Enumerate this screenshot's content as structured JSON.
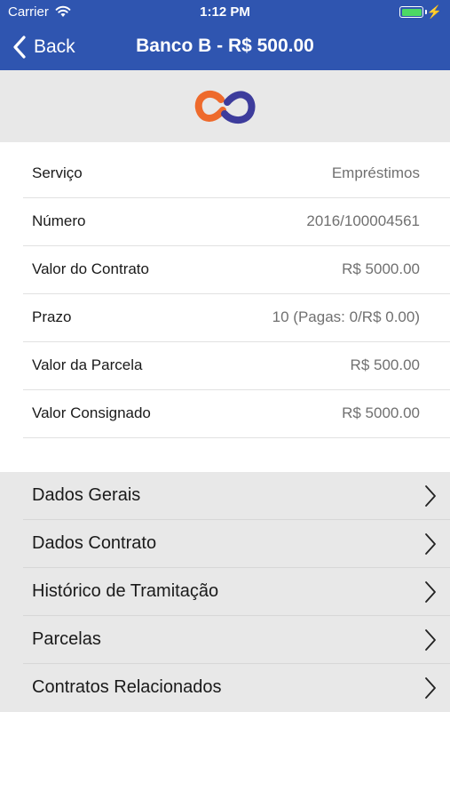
{
  "status_bar": {
    "carrier": "Carrier",
    "time": "1:12 PM",
    "battery_color": "#4cd964"
  },
  "nav": {
    "back_label": "Back",
    "title": "Banco B - R$ 500.00",
    "bar_color": "#2f55b0"
  },
  "details": [
    {
      "label": "Serviço",
      "value": "Empréstimos"
    },
    {
      "label": "Número",
      "value": "2016/100004561"
    },
    {
      "label": "Valor do Contrato",
      "value": "R$ 5000.00"
    },
    {
      "label": "Prazo",
      "value": "10 (Pagas: 0/R$ 0.00)"
    },
    {
      "label": "Valor da Parcela",
      "value": "R$ 500.00"
    },
    {
      "label": "Valor Consignado",
      "value": "R$ 5000.00"
    }
  ],
  "menu": [
    {
      "label": "Dados Gerais"
    },
    {
      "label": "Dados Contrato"
    },
    {
      "label": "Histórico de Tramitação"
    },
    {
      "label": "Parcelas"
    },
    {
      "label": "Contratos Relacionados"
    }
  ],
  "icons": {
    "logo": "infinity-logo-icon",
    "wifi": "wifi-icon",
    "battery": "battery-icon",
    "charging": "charging-bolt-icon",
    "back": "chevron-left-icon",
    "disclosure": "chevron-right-icon"
  }
}
